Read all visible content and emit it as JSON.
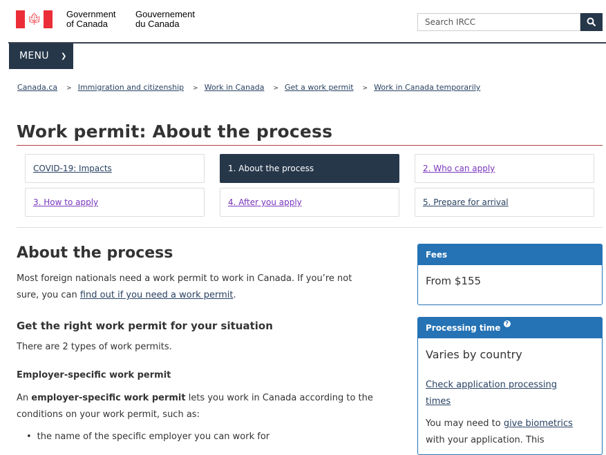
{
  "header": {
    "sig_en_line1": "Government",
    "sig_en_line2": "of Canada",
    "sig_fr_line1": "Gouvernement",
    "sig_fr_line2": "du Canada",
    "search_placeholder": "Search IRCC",
    "flag_color": "#eb2d37",
    "menu_label": "MENU"
  },
  "breadcrumb": [
    "Canada.ca",
    "Immigration and citizenship",
    "Work in Canada",
    "Get a work permit",
    "Work in Canada temporarily"
  ],
  "page": {
    "title": "Work permit: About the process",
    "steps": [
      {
        "label": "COVID-19: Impacts",
        "active": false
      },
      {
        "label": "1. About the process",
        "active": true
      },
      {
        "label": "2. Who can apply",
        "active": false
      },
      {
        "label": "3. How to apply",
        "active": false
      },
      {
        "label": "4. After you apply",
        "active": false
      },
      {
        "label": "5. Prepare for arrival",
        "active": false
      }
    ]
  },
  "main": {
    "heading": "About the process",
    "intro_1": "Most foreign nationals need a work permit to work in Canada. If you’re not",
    "intro_2a": "sure, you can ",
    "intro_link": "find out if you need a work permit",
    "intro_2b": ".",
    "subheading": "Get the right work permit for your situation",
    "types_text": "There are 2 types of work permits.",
    "employer_heading": "Employer-specific work permit",
    "employer_p1a": "An ",
    "employer_p1_bold": "employer-specific work permit",
    "employer_p1b": " lets you work in Canada according to the",
    "employer_p2": "conditions on your work permit, such as:",
    "bullet_1": "the name of the specific employer you can work for"
  },
  "sidebar": {
    "fees_title": "Fees",
    "fees_value": "From $155",
    "processing_title": "Processing time",
    "processing_value": "Varies by country",
    "processing_link_1": "Check application processing",
    "processing_link_2": "times",
    "biometrics_a": "You may need to ",
    "biometrics_link": "give biometrics",
    "biometrics_b": "with your application. This"
  },
  "colors": {
    "brand_dark": "#26374a",
    "panel_blue": "#2572b4",
    "title_rule": "#af3c43",
    "link": "#284162"
  }
}
